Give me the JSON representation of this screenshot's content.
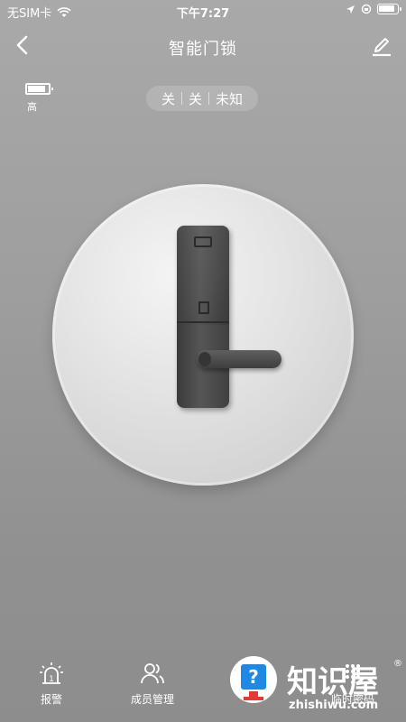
{
  "status_bar": {
    "carrier": "无SIM卡",
    "time": "下午7:27"
  },
  "nav": {
    "title": "智能门锁",
    "back_icon": "chevron-left-icon",
    "edit_icon": "pencil-icon"
  },
  "device": {
    "battery_label": "高",
    "battery_level": 0.85
  },
  "lock_status": {
    "segments": [
      "关",
      "关",
      "未知"
    ]
  },
  "tabs": [
    {
      "label": "报警",
      "icon": "alarm-icon"
    },
    {
      "label": "成员管理",
      "icon": "members-icon"
    },
    {
      "label": "",
      "icon": "calendar-icon"
    },
    {
      "label": "临时密码",
      "icon": "keypad-icon"
    }
  ],
  "watermark": {
    "title": "知识屋",
    "subtitle": "zhishiwu.com",
    "registered": "®"
  }
}
